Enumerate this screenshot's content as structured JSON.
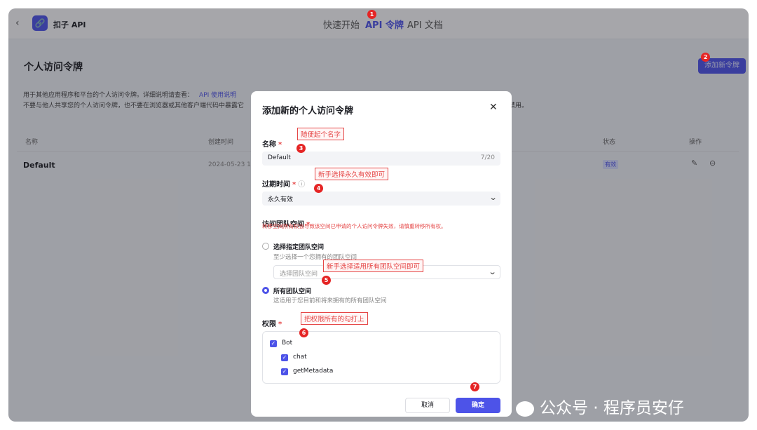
{
  "app": {
    "back_icon": "chevron-left-icon",
    "logo_icon": "link-icon",
    "name": "扣子 API"
  },
  "nav": {
    "tabs": [
      {
        "label": "快速开始"
      },
      {
        "label": "API 令牌"
      },
      {
        "label": "API 文档"
      }
    ],
    "active": 1
  },
  "page": {
    "title": "个人访问令牌",
    "add_button": "添加新令牌",
    "desc_line1": "用于其他应用程序和平台的个人访问令牌。详细说明请查看：",
    "desc_link": "API 使用说明",
    "desc_line2": "不要与他人共享您的个人访问令牌，也不要在浏览器或其他客户端代码中暴露它",
    "desc_line2_tail": "禁用。"
  },
  "table": {
    "headers": {
      "name": "名称",
      "created": "创建时间",
      "status": "状态",
      "actions": "操作"
    },
    "rows": [
      {
        "name": "Default",
        "created": "2024-05-23 16:",
        "status": "有效"
      }
    ]
  },
  "modal": {
    "title": "添加新的个人访问令牌",
    "close_icon": "close-icon",
    "name_label": "名称",
    "name_value": "Default",
    "name_count": "7/20",
    "expire_label": "过期时间",
    "expire_value": "永久有效",
    "space_label": "访问团队空间",
    "space_warning": "转移空间所有权会导致该空间已申请的个人访问令牌失效，请慎重转移所有权。",
    "option1_label": "选择指定团队空间",
    "option1_sub": "至少选择一个您拥有的团队空间",
    "option1_placeholder": "选择团队空间",
    "option2_label": "所有团队空间",
    "option2_sub": "这适用于您目前和将来拥有的所有团队空间",
    "perm_label": "权限",
    "perms": [
      {
        "label": "Bot",
        "checked": true
      },
      {
        "label": "chat",
        "checked": true
      },
      {
        "label": "getMetadata",
        "checked": true
      }
    ],
    "cancel": "取消",
    "confirm": "确定",
    "required_mark": "*"
  },
  "annotations": {
    "n1": "随便起个名字",
    "n2": "新手选择永久有效即可",
    "n3": "新手选择适用所有团队空间即可",
    "n4": "把权限所有的勾打上",
    "markers": [
      "1",
      "2",
      "3",
      "4",
      "5",
      "6",
      "7"
    ]
  },
  "watermark": "公众号 · 程序员安仔",
  "colors": {
    "accent": "#4d53e8",
    "annotation": "#e52525"
  }
}
